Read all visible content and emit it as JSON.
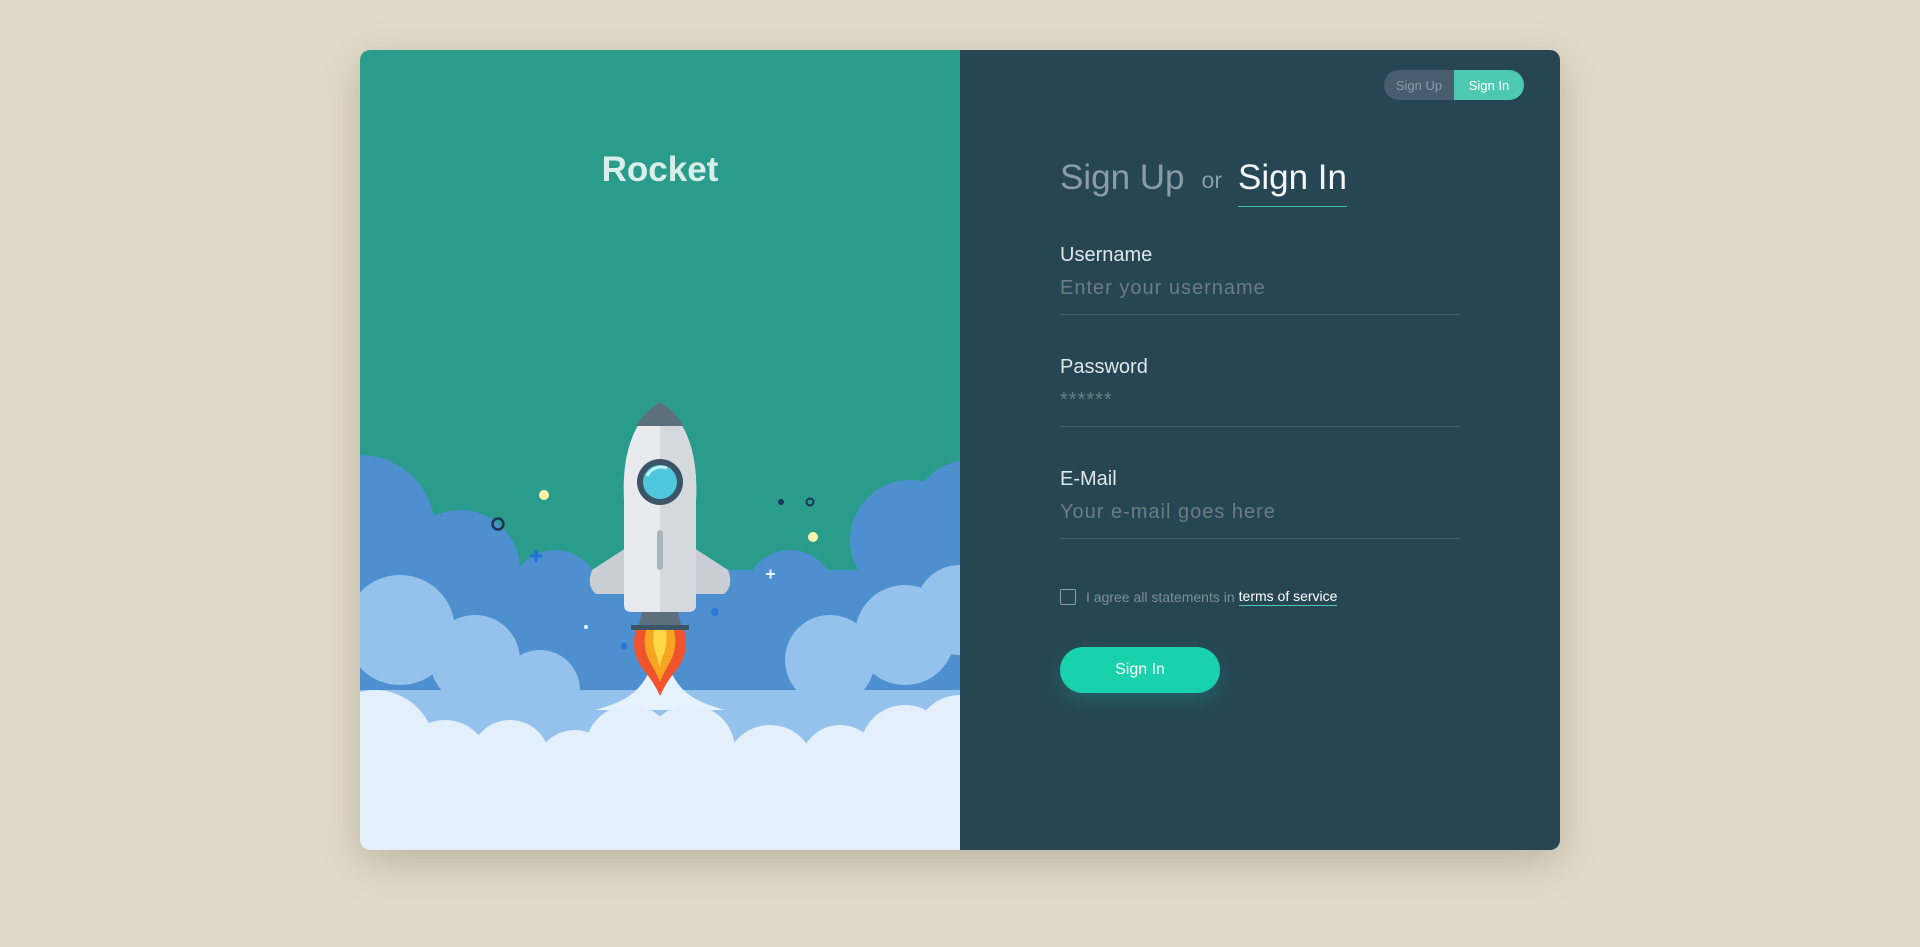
{
  "brand": {
    "name": "Rocket"
  },
  "toggle": {
    "signup_label": "Sign Up",
    "signin_label": "Sign In",
    "active": "Sign In"
  },
  "heading": {
    "signup": "Sign Up",
    "or": "or",
    "signin": "Sign In"
  },
  "fields": {
    "username": {
      "label": "Username",
      "placeholder": "Enter your username"
    },
    "password": {
      "label": "Password",
      "placeholder": "******"
    },
    "email": {
      "label": "E-Mail",
      "placeholder": "Your e-mail goes here"
    }
  },
  "terms": {
    "text": "I agree all statements in",
    "link": "terms of service",
    "checked": false
  },
  "submit": {
    "label": "Sign In"
  },
  "colors": {
    "page_bg": "#e2dac9",
    "left_panel": "#2a9c8c",
    "right_panel": "#264653",
    "accent": "#19d2ad",
    "toggle_active": "#4cc9b0"
  },
  "illustration": {
    "icon": "rocket-launch-illustration"
  }
}
